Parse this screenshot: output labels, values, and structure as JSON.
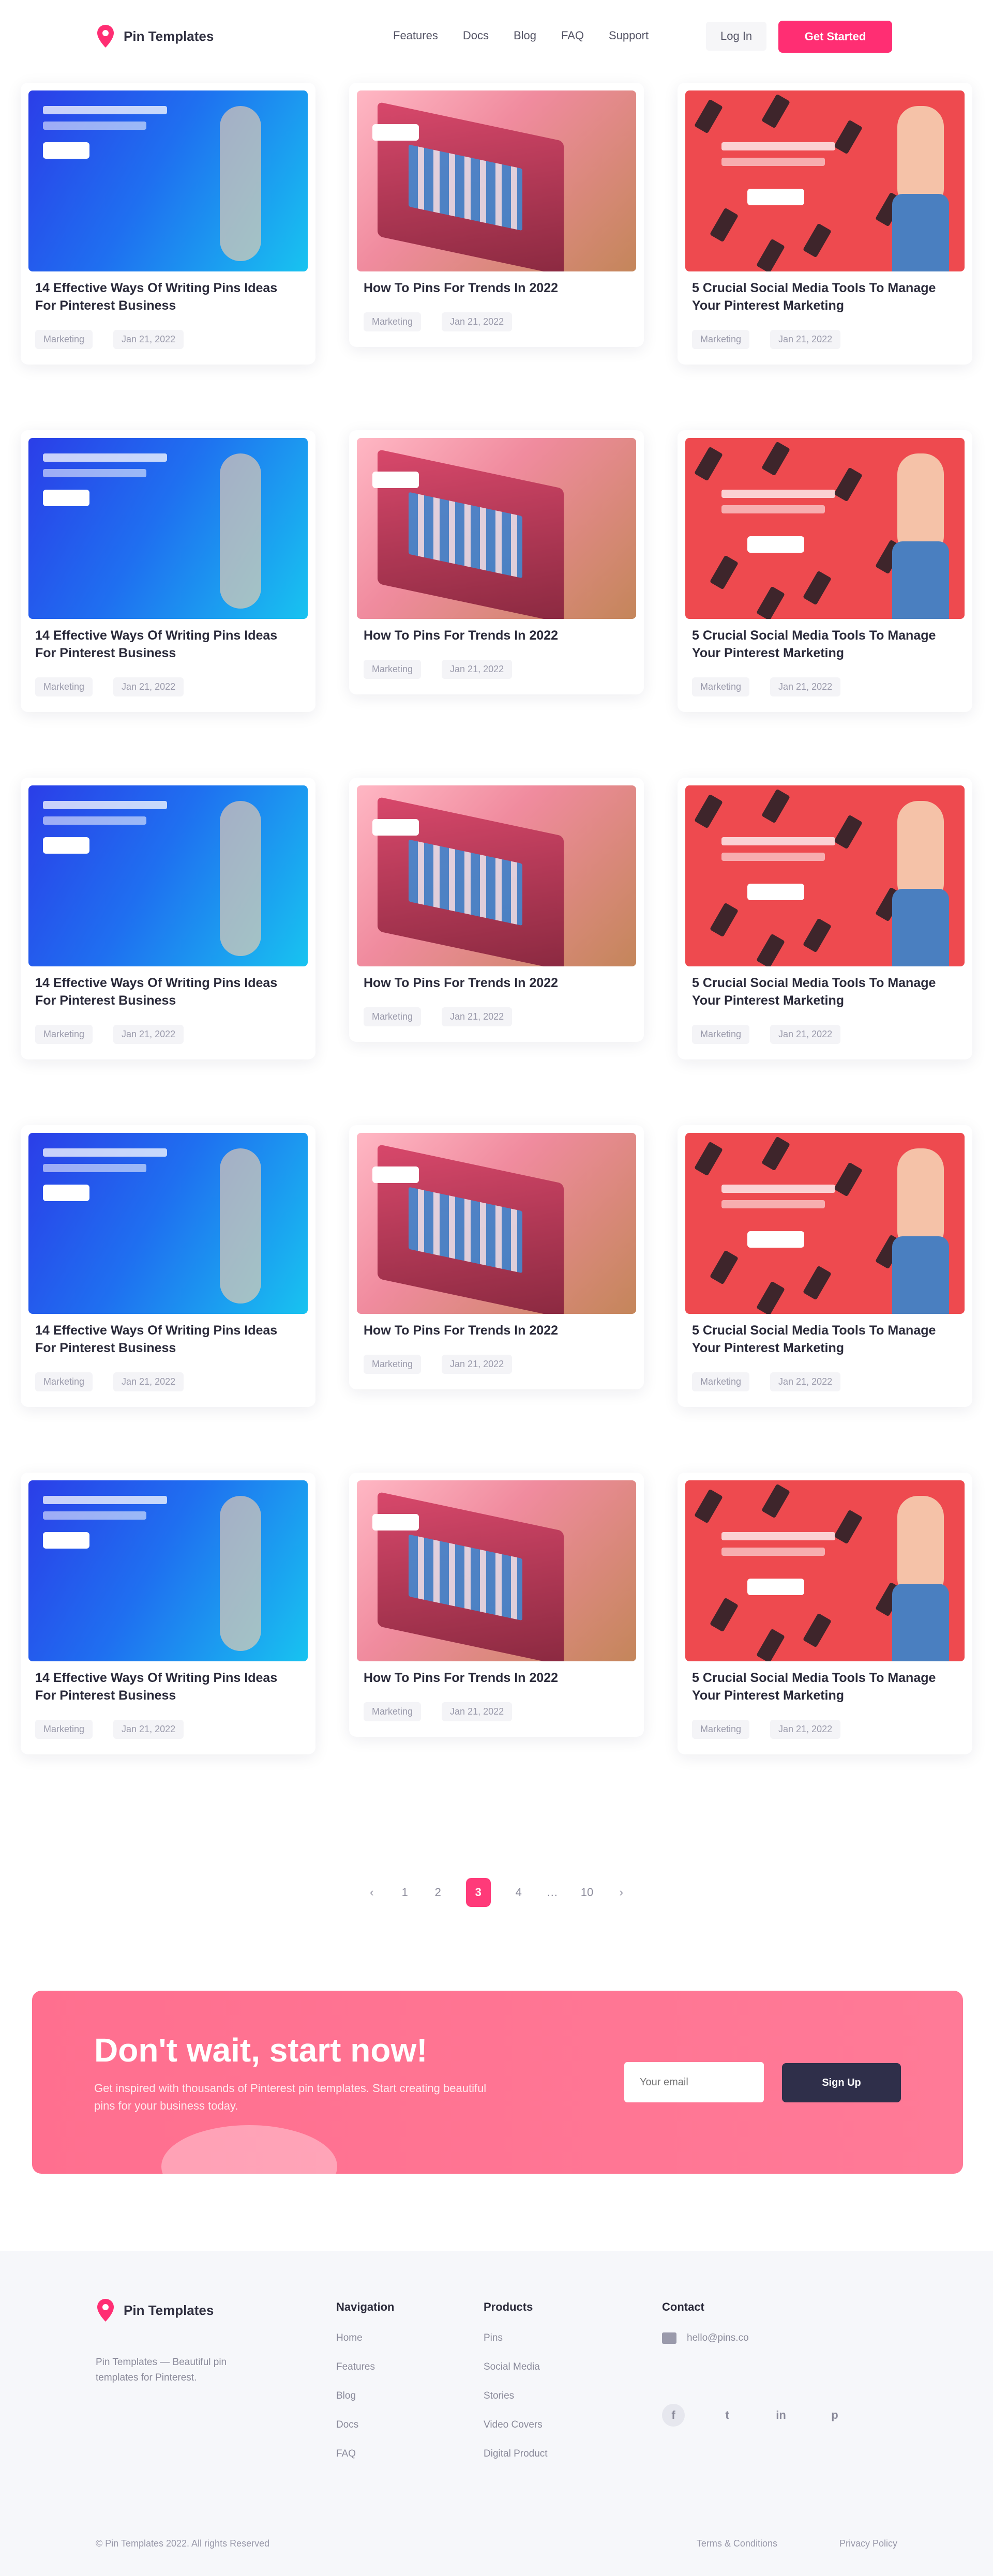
{
  "header": {
    "brand": "Pin Templates",
    "nav": [
      "Features",
      "Docs",
      "Blog",
      "FAQ",
      "Support"
    ],
    "login": "Log In",
    "cta": "Get Started"
  },
  "colors": {
    "accent": "#ff2e73",
    "banner": "#ff7290",
    "dark_button": "#2f2f4a"
  },
  "cards": [
    {
      "theme": "blue",
      "title": "14 Effective Ways Of Writing Pins Ideas For Pinterest Business",
      "category": "Marketing",
      "date": "Jan 21, 2022"
    },
    {
      "theme": "pink",
      "title": "How To Pins For Trends In 2022",
      "category": "Marketing",
      "date": "Jan 21, 2022"
    },
    {
      "theme": "red",
      "title": "5 Crucial Social Media Tools To Manage Your Pinterest Marketing",
      "category": "Marketing",
      "date": "Jan 21, 2022"
    },
    {
      "theme": "blue",
      "title": "14 Effective Ways Of Writing Pins Ideas For Pinterest Business",
      "category": "Marketing",
      "date": "Jan 21, 2022"
    },
    {
      "theme": "pink",
      "title": "How To Pins For Trends In 2022",
      "category": "Marketing",
      "date": "Jan 21, 2022"
    },
    {
      "theme": "red",
      "title": "5 Crucial Social Media Tools To Manage Your Pinterest Marketing",
      "category": "Marketing",
      "date": "Jan 21, 2022"
    },
    {
      "theme": "blue",
      "title": "14 Effective Ways Of Writing Pins Ideas For Pinterest Business",
      "category": "Marketing",
      "date": "Jan 21, 2022"
    },
    {
      "theme": "pink",
      "title": "How To Pins For Trends In 2022",
      "category": "Marketing",
      "date": "Jan 21, 2022"
    },
    {
      "theme": "red",
      "title": "5 Crucial Social Media Tools To Manage Your Pinterest Marketing",
      "category": "Marketing",
      "date": "Jan 21, 2022"
    },
    {
      "theme": "blue",
      "title": "14 Effective Ways Of Writing Pins Ideas For Pinterest Business",
      "category": "Marketing",
      "date": "Jan 21, 2022"
    },
    {
      "theme": "pink",
      "title": "How To Pins For Trends In 2022",
      "category": "Marketing",
      "date": "Jan 21, 2022"
    },
    {
      "theme": "red",
      "title": "5 Crucial Social Media Tools To Manage Your Pinterest Marketing",
      "category": "Marketing",
      "date": "Jan 21, 2022"
    },
    {
      "theme": "blue",
      "title": "14 Effective Ways Of Writing Pins Ideas For Pinterest Business",
      "category": "Marketing",
      "date": "Jan 21, 2022"
    },
    {
      "theme": "pink",
      "title": "How To Pins For Trends In 2022",
      "category": "Marketing",
      "date": "Jan 21, 2022"
    },
    {
      "theme": "red",
      "title": "5 Crucial Social Media Tools To Manage Your Pinterest Marketing",
      "category": "Marketing",
      "date": "Jan 21, 2022"
    }
  ],
  "pagination": {
    "prev": "‹",
    "pages": [
      "1",
      "2",
      "3",
      "4",
      "…",
      "10"
    ],
    "active": "3",
    "next": "›"
  },
  "banner": {
    "title": "Don't wait, start now!",
    "text": "Get inspired with thousands of Pinterest pin templates. Start creating beautiful pins for your business today.",
    "email_placeholder": "Your email",
    "button": "Sign Up"
  },
  "footer": {
    "brand": "Pin Templates",
    "description": "Pin Templates — Beautiful pin templates for Pinterest.",
    "columns": [
      {
        "title": "Navigation",
        "items": [
          "Home",
          "Features",
          "Blog",
          "Docs",
          "FAQ"
        ]
      },
      {
        "title": "Products",
        "items": [
          "Pins",
          "Social Media",
          "Stories",
          "Video Covers",
          "Digital Product"
        ]
      }
    ],
    "contact_title": "Contact",
    "email": "hello@pins.co",
    "socials": [
      "f",
      "t",
      "in",
      "p"
    ],
    "copyright": "© Pin Templates 2022. All rights Reserved",
    "links": [
      "Terms & Conditions",
      "Privacy Policy"
    ]
  }
}
